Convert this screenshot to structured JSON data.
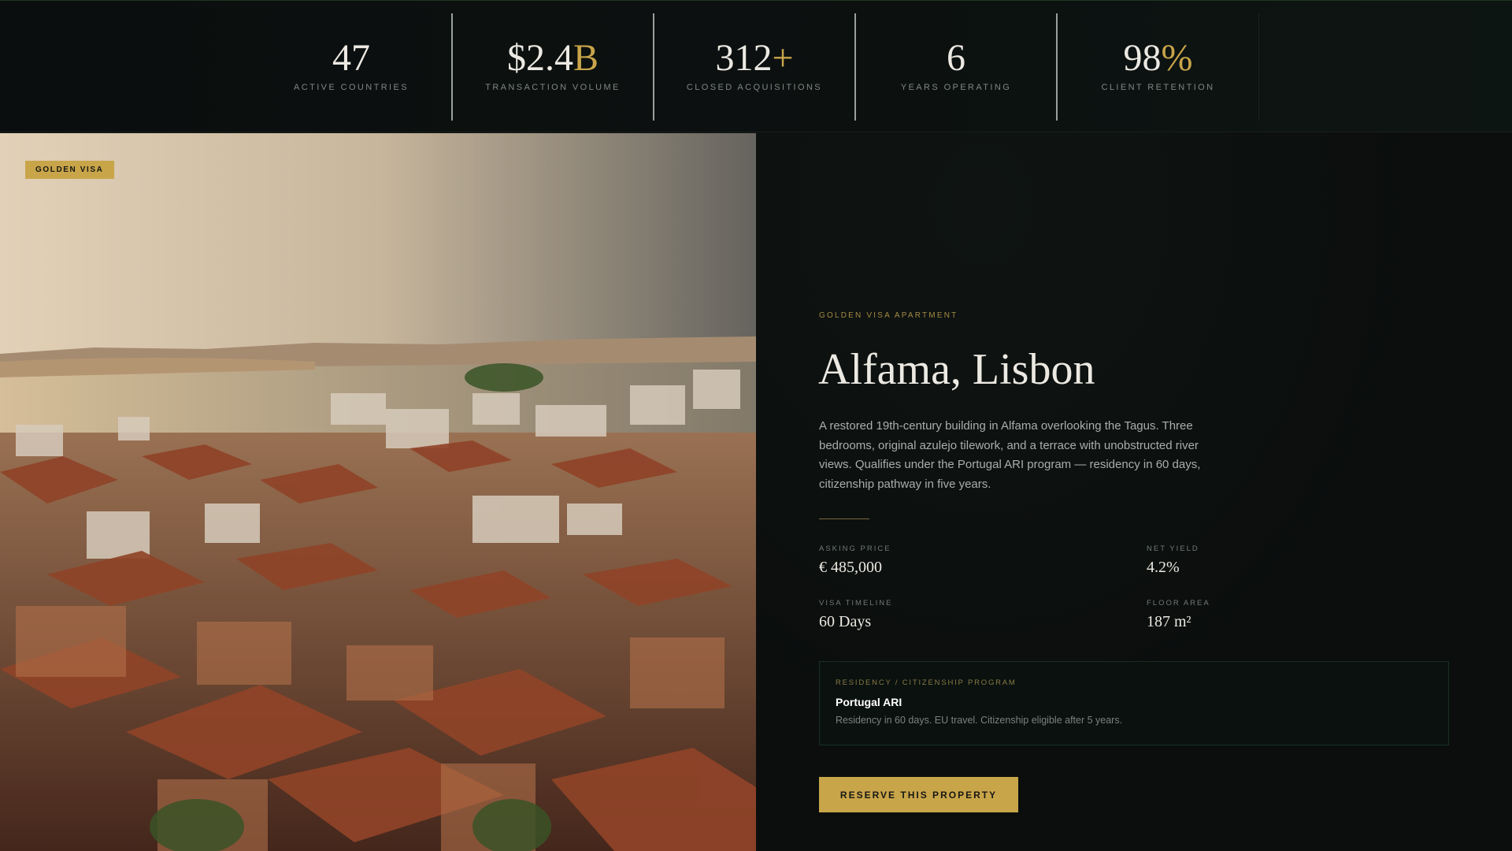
{
  "stats": [
    {
      "value": "47",
      "accent": "",
      "label": "ACTIVE COUNTRIES"
    },
    {
      "value": "$2.4",
      "accent": "B",
      "label": "TRANSACTION VOLUME"
    },
    {
      "value": "312",
      "accent": "+",
      "label": "CLOSED ACQUISITIONS"
    },
    {
      "value": "6",
      "accent": "",
      "label": "YEARS OPERATING"
    },
    {
      "value": "98",
      "accent": "%",
      "label": "CLIENT RETENTION"
    }
  ],
  "hero": {
    "badge": "GOLDEN VISA"
  },
  "property": {
    "eyebrow": "GOLDEN VISA APARTMENT",
    "title": "Alfama, Lisbon",
    "description": "A restored 19th-century building in Alfama overlooking the Tagus. Three bedrooms, original azulejo tilework, and a terrace with unobstructed river views. Qualifies under the Portugal ARI program — residency in 60 days, citizenship pathway in five years.",
    "metrics": [
      {
        "label": "ASKING PRICE",
        "value": "€ 485,000"
      },
      {
        "label": "NET YIELD",
        "value": "4.2%"
      },
      {
        "label": "VISA TIMELINE",
        "value": "60 Days"
      },
      {
        "label": "FLOOR AREA",
        "value": "187 m²"
      }
    ],
    "program": {
      "eyebrow": "RESIDENCY / CITIZENSHIP PROGRAM",
      "name": "Portugal ARI",
      "description": "Residency in 60 days. EU travel. Citizenship eligible after 5 years."
    },
    "cta_label": "RESERVE THIS PROPERTY"
  },
  "colors": {
    "accent": "#c9a54a",
    "background": "#0b0e0d",
    "text": "#ece9e2"
  }
}
